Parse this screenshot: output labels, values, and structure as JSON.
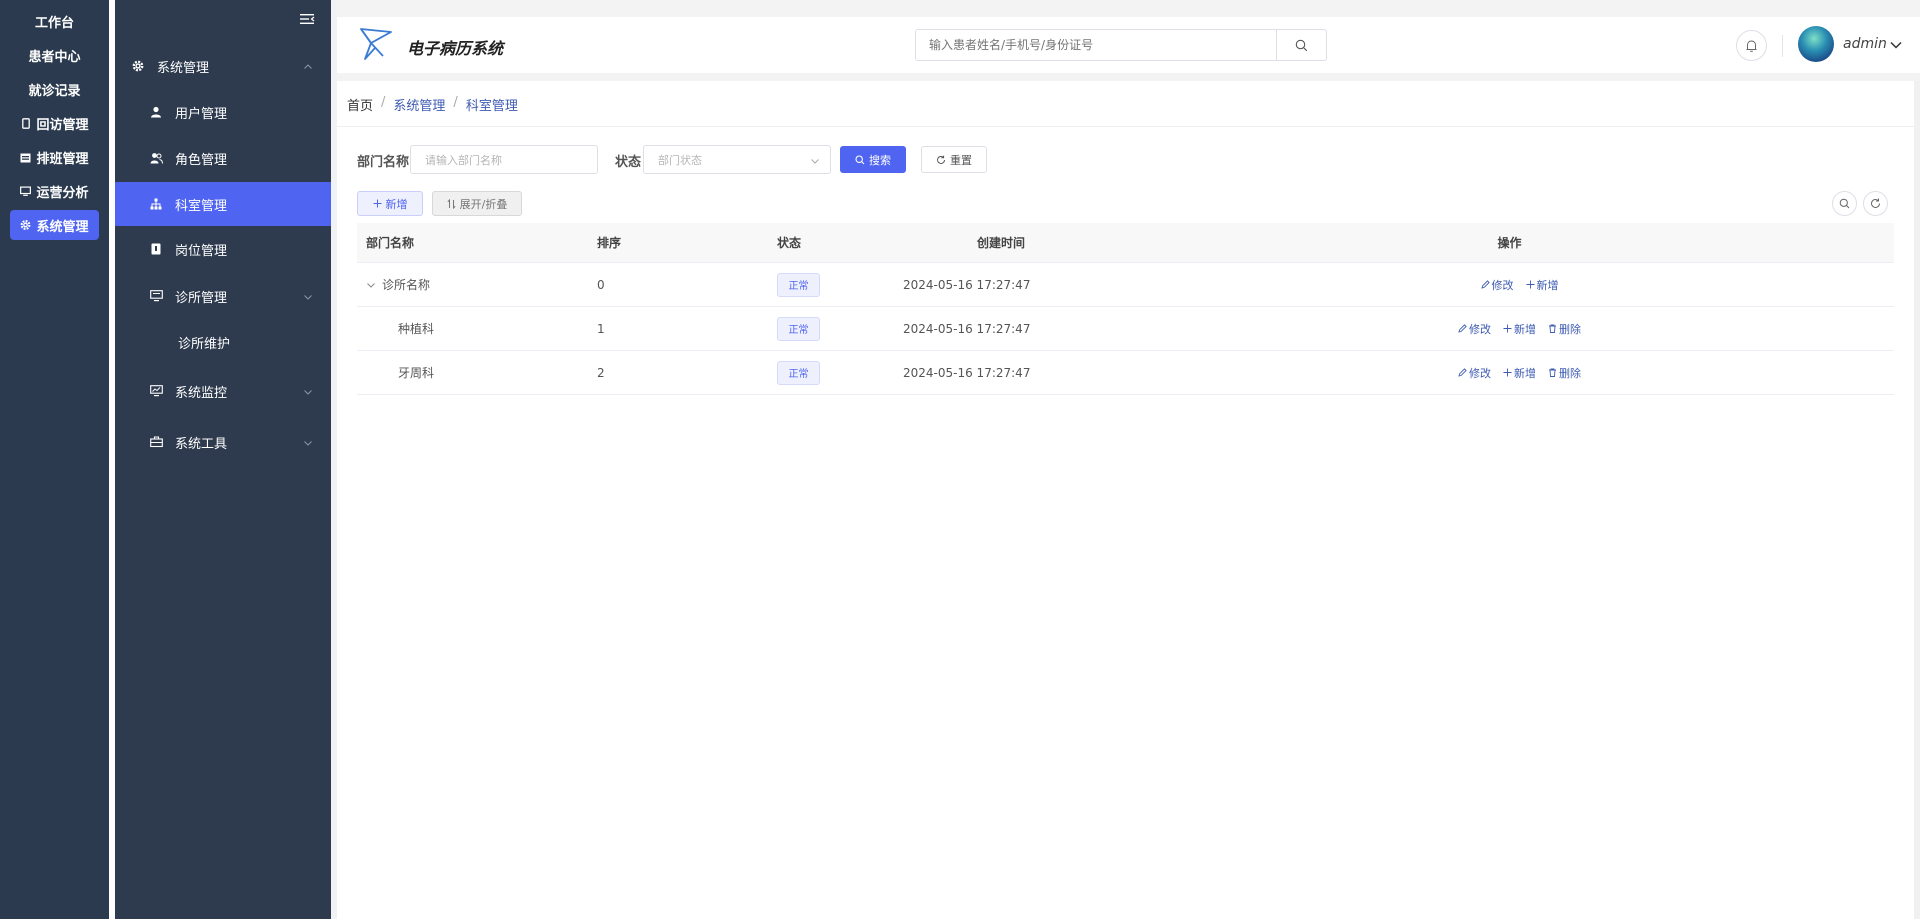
{
  "rail": {
    "items": [
      {
        "label": "工作台",
        "icon": "",
        "active": false
      },
      {
        "label": "患者中心",
        "icon": "",
        "active": false
      },
      {
        "label": "就诊记录",
        "icon": "",
        "active": false
      },
      {
        "label": "回访管理",
        "icon": "phone-icon",
        "active": false
      },
      {
        "label": "排班管理",
        "icon": "calendar-icon",
        "active": false
      },
      {
        "label": "运营分析",
        "icon": "monitor-icon",
        "active": false
      },
      {
        "label": "系统管理",
        "icon": "gear-icon",
        "active": true
      }
    ]
  },
  "sidebar": {
    "items": [
      {
        "label": "系统管理",
        "icon": "gear-icon"
      },
      {
        "label": "用户管理",
        "icon": "user-icon"
      },
      {
        "label": "角色管理",
        "icon": "users-icon"
      },
      {
        "label": "科室管理",
        "icon": "tree-structure-icon"
      },
      {
        "label": "岗位管理",
        "icon": "badge-icon"
      },
      {
        "label": "诊所管理",
        "icon": "monitor-icon"
      },
      {
        "label": "诊所维护",
        "icon": ""
      },
      {
        "label": "系统监控",
        "icon": "chart-monitor-icon"
      },
      {
        "label": "系统工具",
        "icon": "toolbox-icon"
      }
    ]
  },
  "header": {
    "app_title": "电子病历系统",
    "search_placeholder": "输入患者姓名/手机号/身份证号",
    "username": "admin"
  },
  "breadcrumb": {
    "home": "首页",
    "level1": "系统管理",
    "level2": "科室管理",
    "separator": "/"
  },
  "filters": {
    "dept_name_label": "部门名称",
    "dept_name_placeholder": "请输入部门名称",
    "status_label": "状态",
    "status_placeholder": "部门状态",
    "search_button": "搜索",
    "reset_button": "重置"
  },
  "toolbar": {
    "add_button": "新增",
    "expand_button": "展开/折叠"
  },
  "table": {
    "columns": [
      "部门名称",
      "排序",
      "状态",
      "创建时间",
      "操作"
    ],
    "rows": [
      {
        "name": "诊所名称",
        "sort": "0",
        "status": "正常",
        "created": "2024-05-16 17:27:47",
        "expandable": true
      },
      {
        "name": "种植科",
        "sort": "1",
        "status": "正常",
        "created": "2024-05-16 17:27:47",
        "expandable": false
      },
      {
        "name": "牙周科",
        "sort": "2",
        "status": "正常",
        "created": "2024-05-16 17:27:47",
        "expandable": false
      }
    ],
    "ops": {
      "edit": "修改",
      "add": "新增",
      "delete": "删除"
    }
  },
  "colors": {
    "primary": "#4f64f1",
    "sidebar_bg": "#2e3b4e",
    "rail_bg": "#2b3a4e",
    "link": "#3d5bb2"
  }
}
